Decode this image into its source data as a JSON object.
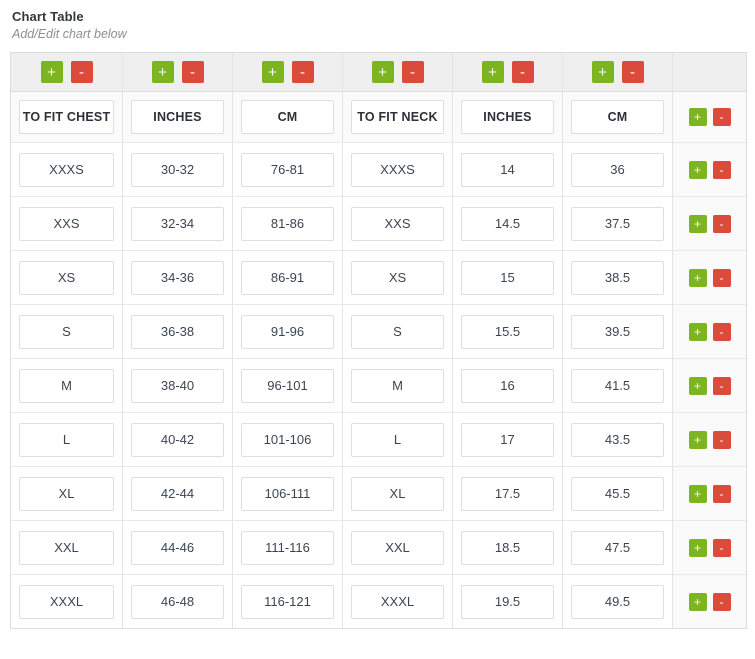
{
  "panel": {
    "title": "Chart Table",
    "subtitle": "Add/Edit chart below"
  },
  "buttons": {
    "add_label": "+",
    "remove_label": "-",
    "add_icon": "plus-icon",
    "remove_icon": "minus-icon"
  },
  "colors": {
    "add": "#7cb51f",
    "remove": "#dc4a3c",
    "toolbar_bg": "#efefef",
    "table_border": "#dddddd",
    "cell_border": "#dedede",
    "title": "#31373d",
    "subtitle": "#8a9196"
  },
  "table": {
    "column_count": 6,
    "headers": [
      "TO FIT CHEST",
      "INCHES",
      "CM",
      "TO FIT NECK",
      "INCHES",
      "CM"
    ],
    "rows": [
      [
        "XXXS",
        "30-32",
        "76-81",
        "XXXS",
        "14",
        "36"
      ],
      [
        "XXS",
        "32-34",
        "81-86",
        "XXS",
        "14.5",
        "37.5"
      ],
      [
        "XS",
        "34-36",
        "86-91",
        "XS",
        "15",
        "38.5"
      ],
      [
        "S",
        "36-38",
        "91-96",
        "S",
        "15.5",
        "39.5"
      ],
      [
        "M",
        "38-40",
        "96-101",
        "M",
        "16",
        "41.5"
      ],
      [
        "L",
        "40-42",
        "101-106",
        "L",
        "17",
        "43.5"
      ],
      [
        "XL",
        "42-44",
        "106-111",
        "XL",
        "17.5",
        "45.5"
      ],
      [
        "XXL",
        "44-46",
        "111-116",
        "XXL",
        "18.5",
        "47.5"
      ],
      [
        "XXXL",
        "46-48",
        "116-121",
        "XXXL",
        "19.5",
        "49.5"
      ]
    ]
  }
}
